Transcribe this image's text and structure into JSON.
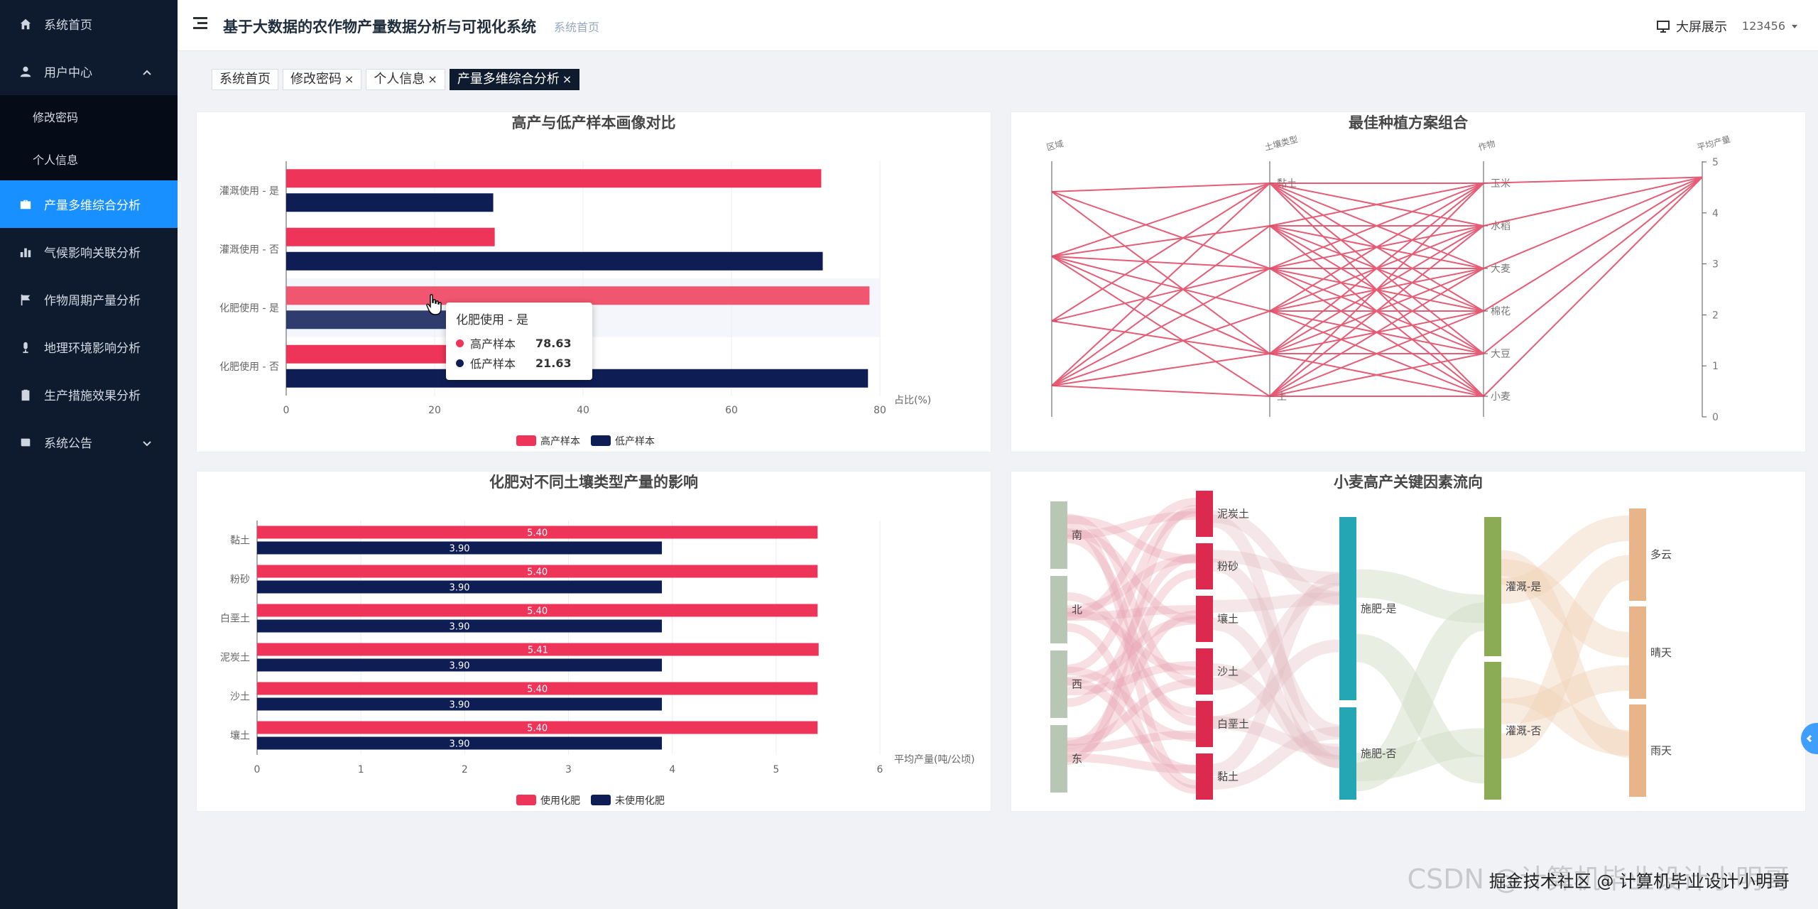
{
  "sidebar": {
    "items": [
      {
        "label": "系统首页",
        "icon": "home-icon"
      },
      {
        "label": "用户中心",
        "icon": "user-icon"
      },
      {
        "label": "修改密码"
      },
      {
        "label": "个人信息"
      },
      {
        "label": "产量多维综合分析",
        "icon": "briefcase-icon"
      },
      {
        "label": "气候影响关联分析",
        "icon": "bar-chart-icon"
      },
      {
        "label": "作物周期产量分析",
        "icon": "flag-icon"
      },
      {
        "label": "地理环境影响分析",
        "icon": "microphone-icon"
      },
      {
        "label": "生产措施效果分析",
        "icon": "clipboard-icon"
      },
      {
        "label": "系统公告",
        "icon": "notice-icon"
      }
    ]
  },
  "header": {
    "title": "基于大数据的农作物产量数据分析与可视化系统",
    "breadcrumb": "系统首页",
    "bigscreen": "大屏展示",
    "user": "123456"
  },
  "tags": [
    "系统首页",
    "修改密码",
    "个人信息",
    "产量多维综合分析"
  ],
  "close_mark": "×",
  "tooltip": {
    "title": "化肥使用 - 是",
    "rows": [
      {
        "name": "高产样本",
        "value": "78.63",
        "color": "#ee3458"
      },
      {
        "name": "低产样本",
        "value": "21.63",
        "color": "#0e1e55"
      }
    ]
  },
  "colors": {
    "red": "#ee3458",
    "navy": "#0e1e55",
    "accent": "#1890ff"
  },
  "chart_data": [
    {
      "type": "bar",
      "orientation": "horizontal",
      "title": "高产与低产样本画像对比",
      "categories": [
        "灌溉使用 - 是",
        "灌溉使用 - 否",
        "化肥使用 - 是",
        "化肥使用 - 否"
      ],
      "series": [
        {
          "name": "高产样本",
          "values": [
            72.1,
            28.1,
            78.6,
            21.6
          ]
        },
        {
          "name": "低产样本",
          "values": [
            27.9,
            72.3,
            21.6,
            78.4
          ]
        }
      ],
      "xlabel": "占比(%)",
      "xlim": [
        0,
        80
      ],
      "xticks": [
        "0",
        "20",
        "40",
        "60",
        "80"
      ],
      "legend": "bottom"
    },
    {
      "type": "parallel",
      "title": "最佳种植方案组合",
      "axes": [
        {
          "name": "区域",
          "ticks": []
        },
        {
          "name": "土壤类型",
          "ticks": [
            "黏土",
            "",
            "",
            "",
            "",
            "土"
          ]
        },
        {
          "name": "作物",
          "ticks": [
            "玉米",
            "水稻",
            "大麦",
            "棉花",
            "大豆",
            "小麦"
          ]
        },
        {
          "name": "平均产量",
          "ticks": [
            "0",
            "1",
            "2",
            "3",
            "4",
            "5"
          ]
        }
      ],
      "value": 4.7
    },
    {
      "type": "bar",
      "orientation": "horizontal",
      "title": "化肥对不同土壤类型产量的影响",
      "categories": [
        "黏土",
        "粉砂",
        "白垩土",
        "泥炭土",
        "沙土",
        "壤土"
      ],
      "series": [
        {
          "name": "使用化肥",
          "values": [
            5.4,
            5.4,
            5.4,
            5.41,
            5.4,
            5.4
          ],
          "labels": [
            "5.40",
            "5.40",
            "5.40",
            "5.41",
            "5.40",
            "5.40"
          ]
        },
        {
          "name": "未使用化肥",
          "values": [
            3.9,
            3.9,
            3.9,
            3.9,
            3.9,
            3.9
          ],
          "labels": [
            "3.90",
            "3.90",
            "3.90",
            "3.90",
            "3.90",
            "3.90"
          ]
        }
      ],
      "xlabel": "平均产量(吨/公顷)",
      "xlim": [
        0,
        6
      ],
      "xticks": [
        "0",
        "1",
        "2",
        "3",
        "4",
        "5",
        "6"
      ],
      "legend": "bottom"
    },
    {
      "type": "sankey",
      "title": "小麦高产关键因素流向",
      "levels": [
        [
          "南",
          "北",
          "西",
          "东"
        ],
        [
          "泥炭土",
          "粉砂",
          "壤土",
          "沙土",
          "白垩土",
          "黏土"
        ],
        [
          "施肥-是",
          "施肥-否"
        ],
        [
          "灌溉-是",
          "灌溉-否"
        ],
        [
          "多云",
          "晴天",
          "雨天"
        ]
      ]
    }
  ],
  "watermark": "CSDN @计算机毕业设计小明哥",
  "watermark2": "掘金技术社区 @ 计算机毕业设计小明哥"
}
